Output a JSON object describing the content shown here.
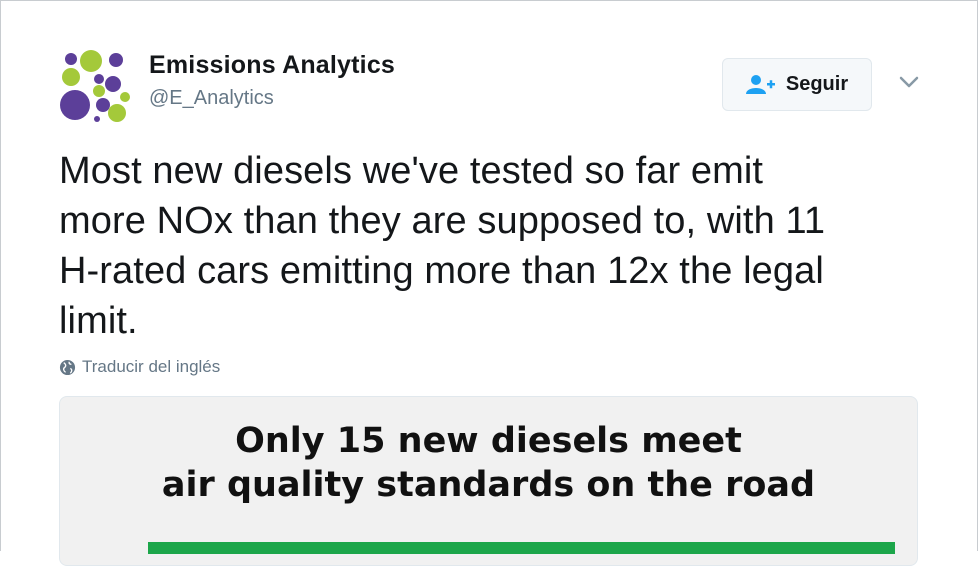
{
  "tweet": {
    "author": {
      "name": "Emissions Analytics",
      "handle": "@E_Analytics",
      "avatar_icon": "bubbles-logo-icon"
    },
    "follow_button": {
      "label": "Seguir",
      "icon": "add-user-icon"
    },
    "menu_icon": "chevron-down-icon",
    "text_lines": [
      "Most new diesels we've tested so far emit",
      "more NOx than they are supposed to, with 11",
      "H-rated cars emitting more than 12x the legal",
      "limit."
    ],
    "translate_link": {
      "label": "Traducir del inglés",
      "icon": "globe-icon"
    },
    "media": {
      "heading_line1": "Only 15 new diesels meet",
      "heading_line2": "air quality standards on the road"
    }
  },
  "colors": {
    "text": "#14171a",
    "secondary": "#657786",
    "follow_icon": "#1da1f2",
    "bar_green": "#1ca64a",
    "avatar_green": "#a4c93a",
    "avatar_purple": "#5c3f99"
  }
}
